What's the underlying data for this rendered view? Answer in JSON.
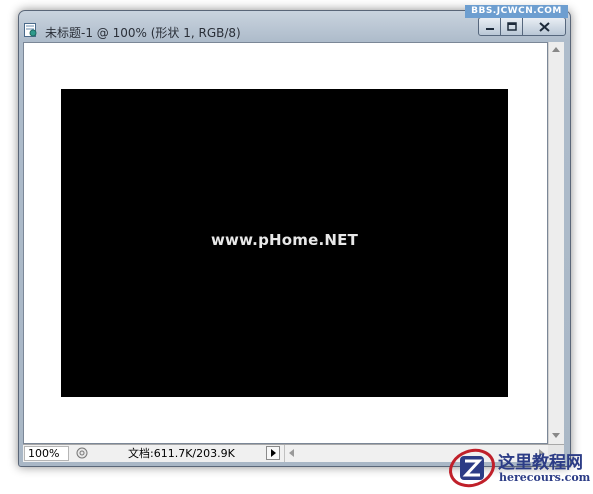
{
  "window": {
    "title": "未标题-1 @ 100% (形状 1, RGB/8)"
  },
  "canvas": {
    "watermark_text": "www.pHome.NET",
    "background_color": "#ffffff",
    "layer_color": "#000000"
  },
  "status_bar": {
    "zoom": "100%",
    "doc_info": "文档:611.7K/203.9K"
  },
  "watermarks": {
    "forum": "BBS.JCWCN.COM",
    "logo_title": "这里教程网",
    "logo_subtitle": "herecours.com"
  },
  "icons": {
    "app_icon": "document-icon",
    "minimize": "minimize-icon",
    "maximize": "maximize-icon",
    "close": "close-icon"
  },
  "colors": {
    "titlebar": "#b7c4d3",
    "accent": "#2c3c86",
    "logo_red": "#c0202a"
  }
}
